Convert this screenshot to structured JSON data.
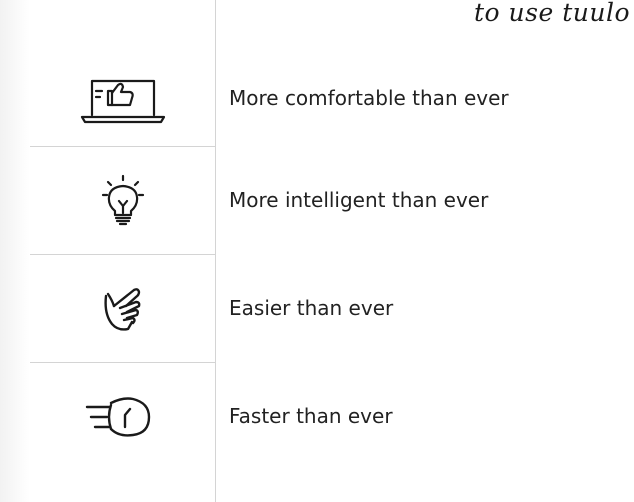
{
  "header": {
    "script_text": "to use tuulo"
  },
  "benefits": [
    {
      "icon": "thumbs-up-laptop-icon",
      "label": "More comfortable than ever"
    },
    {
      "icon": "lightbulb-icon",
      "label": "More intelligent than ever"
    },
    {
      "icon": "pointing-hand-icon",
      "label": "Easier than ever"
    },
    {
      "icon": "fast-clock-icon",
      "label": "Faster than ever"
    }
  ],
  "colors": {
    "text": "#222222",
    "divider": "#d4d4d4",
    "icon": "#1a1a1a"
  }
}
